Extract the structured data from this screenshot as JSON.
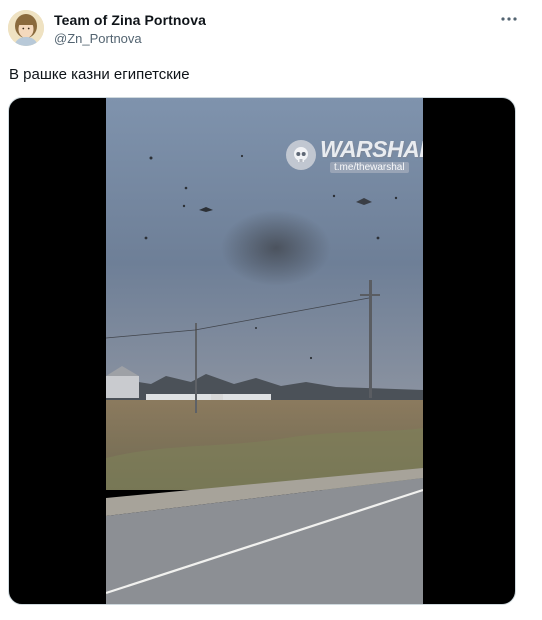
{
  "author": {
    "display_name": "Team of Zina Portnova",
    "handle": "@Zn_Portnova"
  },
  "tweet": {
    "text": "В рашке казни египетские"
  },
  "icons": {
    "more": "more-horizontal-icon",
    "watermark_badge": "skull-logo-icon"
  },
  "media": {
    "type": "video",
    "watermark": {
      "title": "WARSHAL",
      "subtitle": "t.me/thewarshal"
    }
  },
  "colors": {
    "text_primary": "#0f1419",
    "text_secondary": "#536471",
    "media_border": "#cfd9de",
    "letterbox": "#000000"
  }
}
